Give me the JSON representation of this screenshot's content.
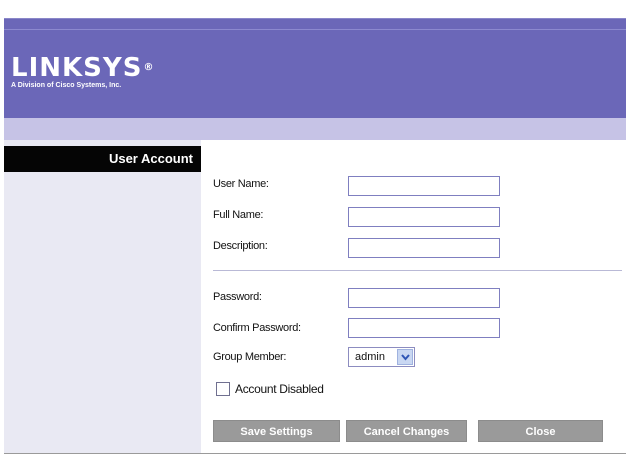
{
  "brand": {
    "logo_text": "LINKSYS",
    "logo_registered": "®",
    "logo_subtitle": "A Division of Cisco Systems, Inc."
  },
  "sidebar": {
    "heading": "User Account"
  },
  "form": {
    "user_name_label": "User Name:",
    "user_name_value": "",
    "full_name_label": "Full Name:",
    "full_name_value": "",
    "description_label": "Description:",
    "description_value": "",
    "password_label": "Password:",
    "password_value": "",
    "confirm_password_label": "Confirm Password:",
    "confirm_password_value": "",
    "group_member_label": "Group Member:",
    "group_member_value": "admin",
    "account_disabled_label": "Account Disabled",
    "account_disabled_checked": false
  },
  "buttons": {
    "save": "Save Settings",
    "cancel": "Cancel Changes",
    "close": "Close"
  },
  "colors": {
    "header_purple": "#6b67b8",
    "band_lavender": "#c6c3e6",
    "sidebar_bg": "#e9e9f3",
    "button_gray": "#9a9a9a"
  }
}
